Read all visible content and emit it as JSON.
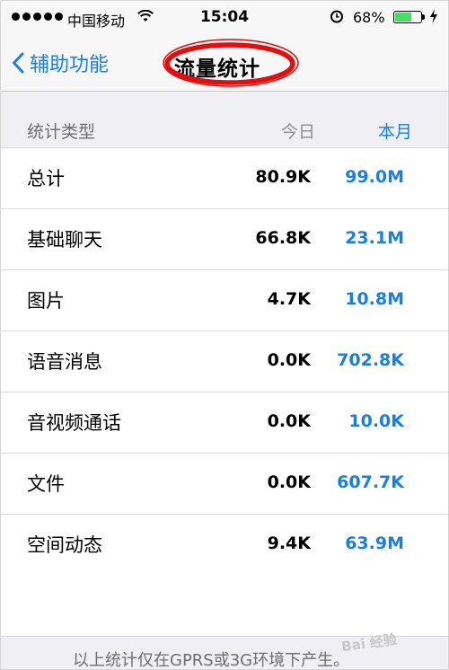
{
  "status_bar": {
    "carrier": "中国移动",
    "time": "15:04",
    "battery": "68%",
    "battery_level": 0.68,
    "icons": [
      "signal-dots-icon",
      "wifi-icon",
      "alarm-icon",
      "battery-icon",
      "charging-icon"
    ]
  },
  "nav": {
    "back_label": "辅助功能",
    "title": "流量统计"
  },
  "header": {
    "type": "统计类型",
    "today": "今日",
    "month": "本月"
  },
  "rows": [
    {
      "name": "总计",
      "today": "80.9K",
      "month": "99.0M"
    },
    {
      "name": "基础聊天",
      "today": "66.8K",
      "month": "23.1M"
    },
    {
      "name": "图片",
      "today": "4.7K",
      "month": "10.8M"
    },
    {
      "name": "语音消息",
      "today": "0.0K",
      "month": "702.8K"
    },
    {
      "name": "音视频通话",
      "today": "0.0K",
      "month": "10.0K"
    },
    {
      "name": "文件",
      "today": "0.0K",
      "month": "607.7K"
    },
    {
      "name": "空间动态",
      "today": "9.4K",
      "month": "63.9M"
    }
  ],
  "footer": {
    "note": "以上统计仅在GPRS或3G环境下产生。"
  },
  "watermark": "Bai 经验",
  "colors": {
    "accent": "#1a7fe0",
    "annotation": "#e01010",
    "battery": "#4cd964"
  }
}
